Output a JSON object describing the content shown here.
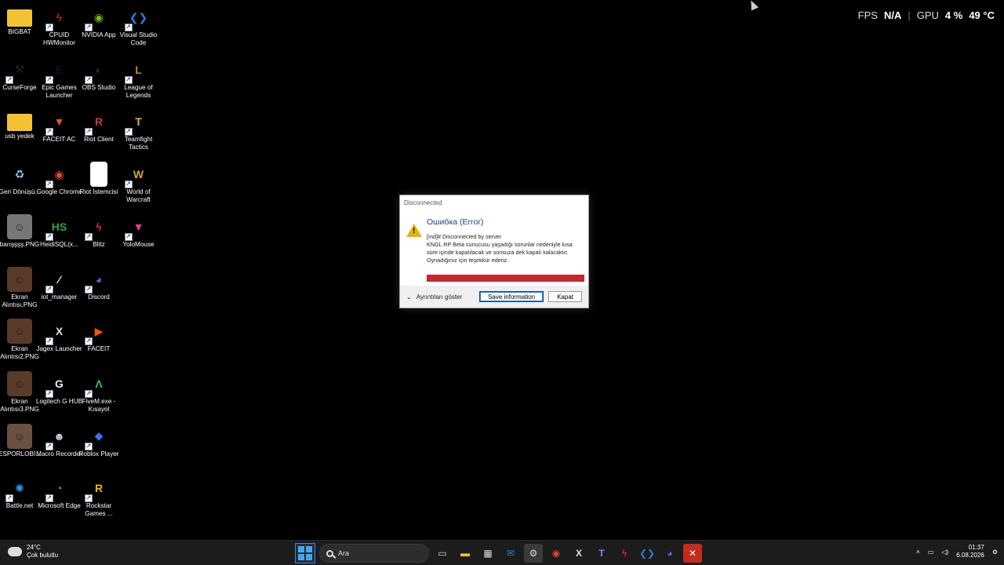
{
  "overlay": {
    "fps_label": "FPS",
    "fps_value": "N/A",
    "gpu_label": "GPU",
    "gpu_usage": "4 %",
    "gpu_temp": "49 °C"
  },
  "desktop_icons": [
    {
      "label": "BIGBAT",
      "icon": "folder-icon",
      "color": "#f2c230",
      "col": 0,
      "row": 0,
      "shortcut": false
    },
    {
      "label": "CPUID HWMonitor",
      "icon": "hwmonitor-icon",
      "color": "#c0262d",
      "col": 1,
      "row": 0,
      "shortcut": true
    },
    {
      "label": "NVIDIA App",
      "icon": "nvidia-icon",
      "color": "#76b900",
      "col": 2,
      "row": 0,
      "shortcut": true
    },
    {
      "label": "Visual Studio Code",
      "icon": "vscode-icon",
      "color": "#2b7ad6",
      "col": 3,
      "row": 0,
      "shortcut": true
    },
    {
      "label": "CurseForge",
      "icon": "curseforge-icon",
      "color": "#222222",
      "col": 0,
      "row": 1,
      "shortcut": true
    },
    {
      "label": "Epic Games Launcher",
      "icon": "epic-games-icon",
      "color": "#111111",
      "col": 1,
      "row": 1,
      "shortcut": true
    },
    {
      "label": "OBS Studio",
      "icon": "obs-icon",
      "color": "#302e3b",
      "col": 2,
      "row": 1,
      "shortcut": true
    },
    {
      "label": "League of Legends",
      "icon": "league-icon",
      "color": "#b38a3d",
      "col": 3,
      "row": 1,
      "shortcut": true
    },
    {
      "label": "usb yedek",
      "icon": "folder-icon",
      "color": "#f2c230",
      "col": 0,
      "row": 2,
      "shortcut": false
    },
    {
      "label": "FACEIT AC",
      "icon": "faceit-ac-icon",
      "color": "#e05a28",
      "col": 1,
      "row": 2,
      "shortcut": true
    },
    {
      "label": "Riot Client",
      "icon": "riot-client-icon",
      "color": "#d13639",
      "col": 2,
      "row": 2,
      "shortcut": true
    },
    {
      "label": "Teamfight Tactics",
      "icon": "tft-icon",
      "color": "#e8b820",
      "col": 3,
      "row": 2,
      "shortcut": true
    },
    {
      "label": "Geri Dönüşü...",
      "icon": "recycle-bin-icon",
      "color": "#8fc7ee",
      "col": 0,
      "row": 3,
      "shortcut": false
    },
    {
      "label": "Google Chrome",
      "icon": "chrome-icon",
      "color": "#e94235",
      "col": 1,
      "row": 3,
      "shortcut": true
    },
    {
      "label": "Riot İstemcisi",
      "icon": "file-icon",
      "color": "#ffffff",
      "col": 2,
      "row": 3,
      "shortcut": false
    },
    {
      "label": "World of Warcraft",
      "icon": "wow-icon",
      "color": "#d4a62a",
      "col": 3,
      "row": 3,
      "shortcut": true
    },
    {
      "label": "barışşşş.PNG",
      "icon": "image-thumbnail-icon",
      "color": "#777777",
      "col": 0,
      "row": 4,
      "shortcut": false
    },
    {
      "label": "HeidiSQL(x...",
      "icon": "heidisql-icon",
      "color": "#2aa640",
      "col": 1,
      "row": 4,
      "shortcut": true
    },
    {
      "label": "Blitz",
      "icon": "blitz-icon",
      "color": "#e2242f",
      "col": 2,
      "row": 4,
      "shortcut": true
    },
    {
      "label": "YoloMouse",
      "icon": "yolomouse-icon",
      "color": "#e23fa0",
      "col": 3,
      "row": 4,
      "shortcut": true
    },
    {
      "label": "Ekran Alıntısı.PNG",
      "icon": "image-thumbnail-icon",
      "color": "#5a3a28",
      "col": 0,
      "row": 5,
      "shortcut": false
    },
    {
      "label": "iot_manager",
      "icon": "iot-manager-icon",
      "color": "#eeeeee",
      "col": 1,
      "row": 5,
      "shortcut": true
    },
    {
      "label": "Discord",
      "icon": "discord-icon",
      "color": "#5865f2",
      "col": 2,
      "row": 5,
      "shortcut": true
    },
    {
      "label": "Ekran Alıntısı2.PNG",
      "icon": "image-thumbnail-icon",
      "color": "#5a3a28",
      "col": 0,
      "row": 6,
      "shortcut": false
    },
    {
      "label": "Jagex Launcher",
      "icon": "jagex-icon",
      "color": "#dddddd",
      "col": 1,
      "row": 6,
      "shortcut": true
    },
    {
      "label": "FACEIT",
      "icon": "faceit-icon",
      "color": "#ff5500",
      "col": 2,
      "row": 6,
      "shortcut": true
    },
    {
      "label": "Ekran Alıntısı3.PNG",
      "icon": "image-thumbnail-icon",
      "color": "#5a3a28",
      "col": 0,
      "row": 7,
      "shortcut": false
    },
    {
      "label": "Logitech G HUB",
      "icon": "logitech-icon",
      "color": "#eeeeee",
      "col": 1,
      "row": 7,
      "shortcut": true
    },
    {
      "label": "FiveM.exe - Kısayol",
      "icon": "fivem-icon",
      "color": "#3fbf5f",
      "col": 2,
      "row": 7,
      "shortcut": true
    },
    {
      "label": "ESPORLOBİ...",
      "icon": "image-thumbnail-icon",
      "color": "#6a5040",
      "col": 0,
      "row": 8,
      "shortcut": false
    },
    {
      "label": "Macro Recorder",
      "icon": "macro-recorder-icon",
      "color": "#cccccc",
      "col": 1,
      "row": 8,
      "shortcut": true
    },
    {
      "label": "Roblox Player",
      "icon": "roblox-icon",
      "color": "#3c6ff0",
      "col": 2,
      "row": 8,
      "shortcut": true
    },
    {
      "label": "Battle.net",
      "icon": "battlenet-icon",
      "color": "#2e9cf0",
      "col": 0,
      "row": 9,
      "shortcut": true
    },
    {
      "label": "Microsoft Edge",
      "icon": "edge-icon",
      "color": "#1bb0a6",
      "col": 1,
      "row": 9,
      "shortcut": true
    },
    {
      "label": "Rockstar Games ...",
      "icon": "rockstar-icon",
      "color": "#f5b800",
      "col": 2,
      "row": 9,
      "shortcut": true
    }
  ],
  "dialog": {
    "title": "Disconnected",
    "heading": "Ошибка (Error)",
    "message_line1": "[md]# Disconnected by server",
    "message_line2": "KNGL RP Beta sunucusu yaşadığı sorunlar nedeniyle kısa süre içinde kapatılacak ve sonsuza dek kapalı kalacaktır.",
    "message_line3": "Oynadığınız için teşekkür ederiz.",
    "details_label": "Ayrıntıları göster",
    "save_label": "Save information",
    "close_label": "Kapat",
    "bar_color": "#c6262e"
  },
  "taskbar": {
    "weather_temp": "24°C",
    "weather_desc": "Çok bulutlu",
    "search_placeholder": "Ara",
    "apps": [
      {
        "name": "task-view-icon",
        "glyph": "▭",
        "color": "#cccccc"
      },
      {
        "name": "file-explorer-icon",
        "glyph": "▬",
        "color": "#f2c230"
      },
      {
        "name": "ms-store-icon",
        "glyph": "▦",
        "color": "#dddddd"
      },
      {
        "name": "outlook-icon",
        "glyph": "✉",
        "color": "#2d7cd6"
      },
      {
        "name": "steam-icon",
        "glyph": "⚙",
        "color": "#cfd8e3",
        "active": true
      },
      {
        "name": "chrome-icon",
        "glyph": "◉",
        "color": "#e94235"
      },
      {
        "name": "jagex-icon",
        "glyph": "X",
        "color": "#dddddd"
      },
      {
        "name": "teams-icon",
        "glyph": "T",
        "color": "#7b83eb"
      },
      {
        "name": "hwmonitor-icon",
        "glyph": "ϟ",
        "color": "#e2242f"
      },
      {
        "name": "vscode-icon",
        "glyph": "❮❯",
        "color": "#2b7ad6"
      },
      {
        "name": "discord-icon",
        "glyph": "◕",
        "color": "#5865f2"
      },
      {
        "name": "error-app-icon",
        "glyph": "✕",
        "color": "#ffffff",
        "active": true,
        "bg": "#c42b1c"
      }
    ],
    "time": "01:37",
    "date": "6.08.2026"
  }
}
